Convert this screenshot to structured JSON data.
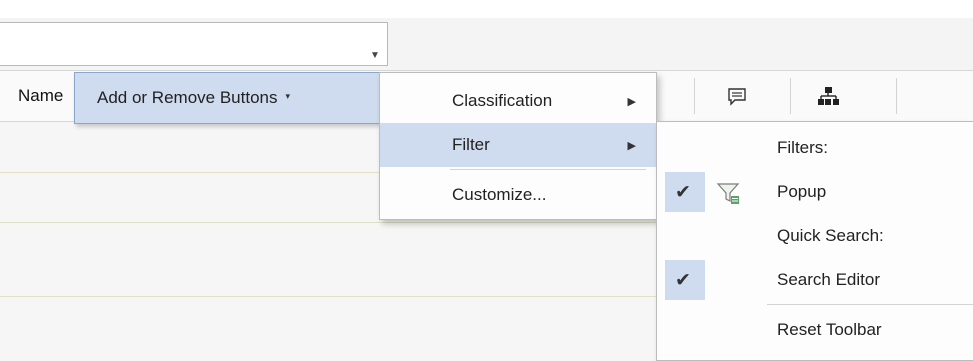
{
  "header": {
    "column_header": "Name"
  },
  "toolbar": {
    "icons": [
      "comment-icon",
      "hierarchy-icon"
    ]
  },
  "dropdown": {
    "label": "Add or Remove Buttons",
    "caret": "▾"
  },
  "menu": {
    "items": [
      {
        "label": "Classification",
        "submenu": true
      },
      {
        "label": "Filter",
        "submenu": true,
        "highlighted": true
      },
      {
        "label": "Customize...",
        "submenu": false
      }
    ]
  },
  "submenu": {
    "filters_header": "Filters:",
    "popup_label": "Popup",
    "popup_checked": true,
    "quick_search_header": "Quick Search:",
    "search_editor_label": "Search Editor",
    "search_editor_checked": true,
    "reset_label": "Reset Toolbar"
  },
  "colors": {
    "highlight": "#cfdbee",
    "highlight_border": "#8aa6cf"
  }
}
